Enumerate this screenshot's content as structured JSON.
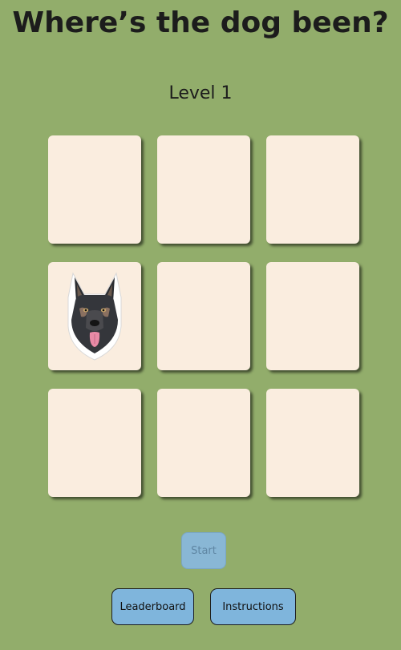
{
  "game": {
    "title": "Where’s the dog been?",
    "level_label": "Level 1"
  },
  "board": {
    "rows": 3,
    "columns": 3,
    "cells": [
      {
        "row": 1,
        "col": 1,
        "content": "empty"
      },
      {
        "row": 1,
        "col": 2,
        "content": "empty"
      },
      {
        "row": 1,
        "col": 3,
        "content": "empty"
      },
      {
        "row": 2,
        "col": 1,
        "content": "dog-icon"
      },
      {
        "row": 2,
        "col": 2,
        "content": "empty"
      },
      {
        "row": 2,
        "col": 3,
        "content": "empty"
      },
      {
        "row": 3,
        "col": 1,
        "content": "empty"
      },
      {
        "row": 3,
        "col": 2,
        "content": "empty"
      },
      {
        "row": 3,
        "col": 3,
        "content": "empty"
      }
    ]
  },
  "controls": {
    "start_label": "Start",
    "start_disabled": true,
    "leaderboard_label": "Leaderboard",
    "instructions_label": "Instructions"
  },
  "colors": {
    "background": "#92ad6b",
    "card": "#faeddf",
    "button": "#7fb5dc",
    "button_disabled": "#89b7d5"
  }
}
